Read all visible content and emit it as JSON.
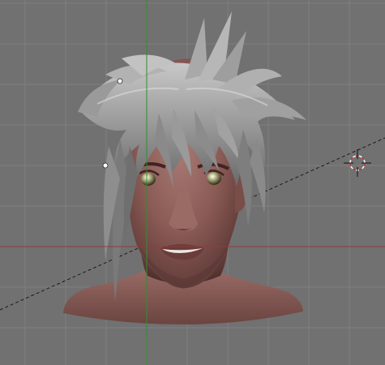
{
  "viewport": {
    "background_color": "#717171",
    "grid_color": "#7e7e7e",
    "x_axis_color": "#8a3d3d",
    "y_axis_color": "#2f8f2f",
    "view_axis_line_color": "#1a1a1a"
  },
  "model": {
    "skin_color": "#8a5a55",
    "skin_shadow_color": "#5a3734",
    "hair_color": "#8f8f8f",
    "hair_highlight_color": "#c4c4c4",
    "eye_color": "#8a8a5a"
  },
  "icons": {
    "cursor": "3d-cursor-icon",
    "object_center": "object-center-icon"
  }
}
